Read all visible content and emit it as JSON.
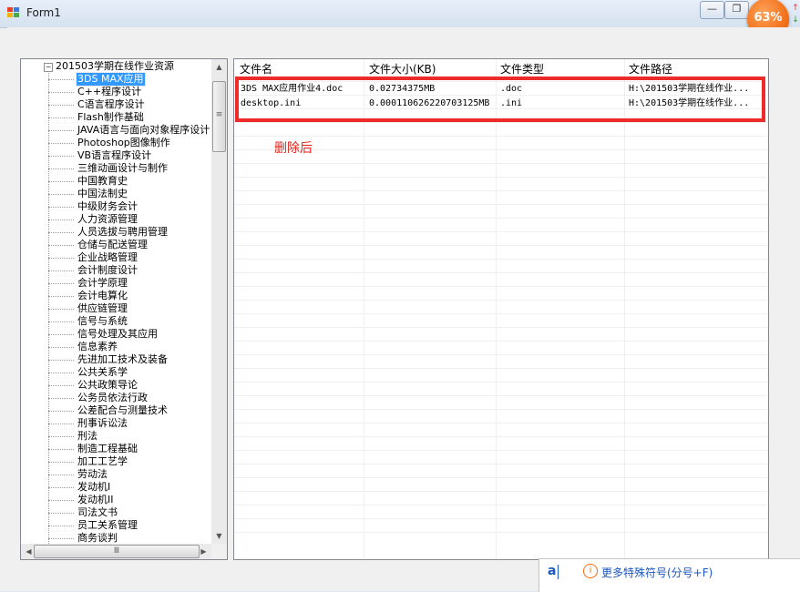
{
  "window": {
    "title": "Form1",
    "overlay_badge": "63%",
    "buttons": {
      "minimize": "—",
      "maximize": "❐"
    }
  },
  "tree": {
    "root": "201503学期在线作业资源",
    "selected_index": 0,
    "items": [
      "3DS MAX应用",
      "C++程序设计",
      "C语言程序设计",
      "Flash制作基础",
      "JAVA语言与面向对象程序设计",
      "Photoshop图像制作",
      "VB语言程序设计",
      "三维动画设计与制作",
      "中国教育史",
      "中国法制史",
      "中级财务会计",
      "人力资源管理",
      "人员选拔与聘用管理",
      "仓储与配送管理",
      "企业战略管理",
      "会计制度设计",
      "会计学原理",
      "会计电算化",
      "供应链管理",
      "信号与系统",
      "信号处理及其应用",
      "信息素养",
      "先进加工技术及装备",
      "公共关系学",
      "公共政策导论",
      "公务员依法行政",
      "公差配合与测量技术",
      "刑事诉讼法",
      "刑法",
      "制造工程基础",
      "加工工艺学",
      "劳动法",
      "发动机I",
      "发动机II",
      "司法文书",
      "员工关系管理",
      "商务谈判"
    ]
  },
  "grid": {
    "columns": [
      "文件名",
      "文件大小(KB)",
      "文件类型",
      "文件路径"
    ],
    "rows": [
      {
        "name": "3DS MAX应用作业4.doc",
        "size": "0.02734375MB",
        "type": ".doc",
        "path": "H:\\201503学期在线作业..."
      },
      {
        "name": "desktop.ini",
        "size": "0.000110626220703125MB",
        "type": ".ini",
        "path": "H:\\201503学期在线作业..."
      }
    ]
  },
  "annotation": "删除后",
  "ime": {
    "typed": "a",
    "hint": "更多特殊符号(分号+F)",
    "icon": "info-icon"
  },
  "colors": {
    "highlight_box": "#ee2b2b",
    "selection": "#3399ff",
    "note_text": "#e2231a",
    "badge": "#f06a12"
  }
}
